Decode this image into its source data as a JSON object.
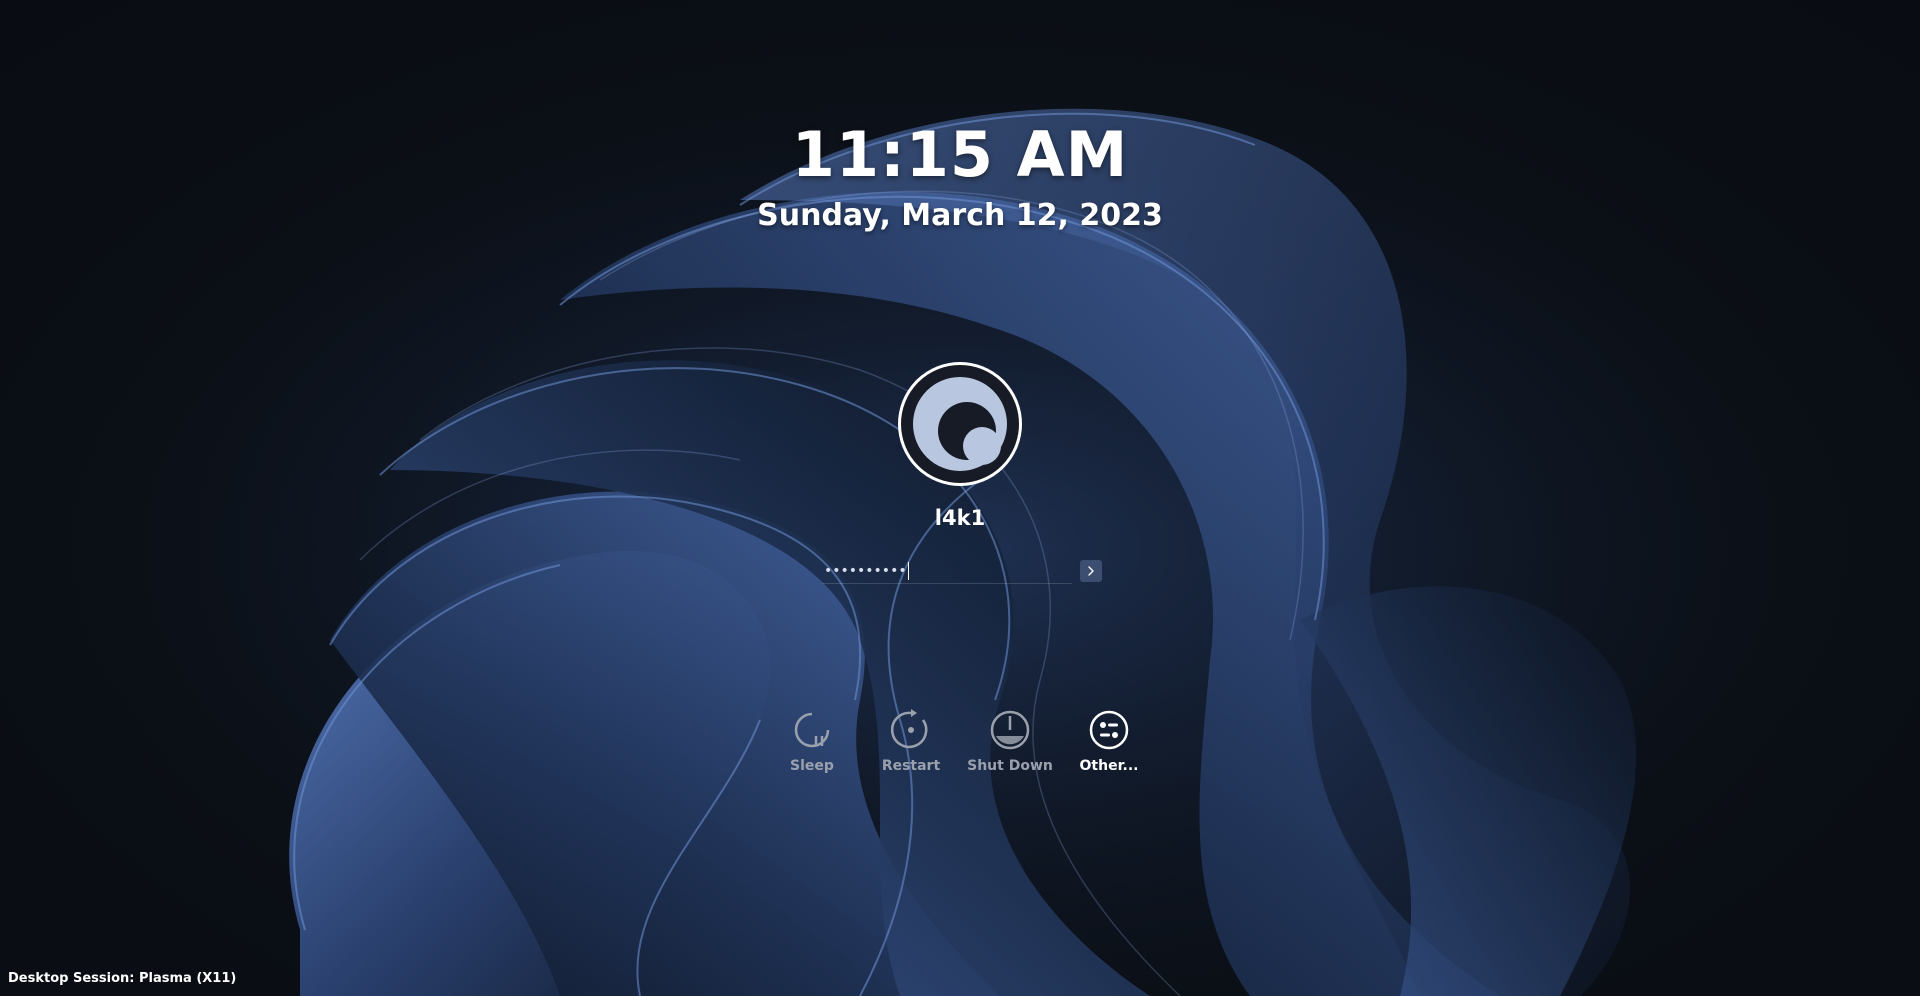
{
  "clock": {
    "time": "11:15 AM",
    "date": "Sunday, March 12, 2023"
  },
  "user": {
    "name": "l4k1",
    "avatar_icon": "avatar-icon"
  },
  "password": {
    "masked_value": "••••••••••",
    "login_icon": "chevron-right-icon"
  },
  "actions": [
    {
      "label": "Sleep",
      "icon": "sleep-icon"
    },
    {
      "label": "Restart",
      "icon": "restart-icon"
    },
    {
      "label": "Shut Down",
      "icon": "power-icon"
    },
    {
      "label": "Other...",
      "icon": "switch-user-icon"
    }
  ],
  "session": {
    "label": "Desktop Session: Plasma (X11)"
  },
  "colors": {
    "background": "#0b0f16",
    "wallpaper_accent": "#3f5f9e",
    "text": "#ffffff",
    "inactive_label": "#9aa1ad"
  }
}
